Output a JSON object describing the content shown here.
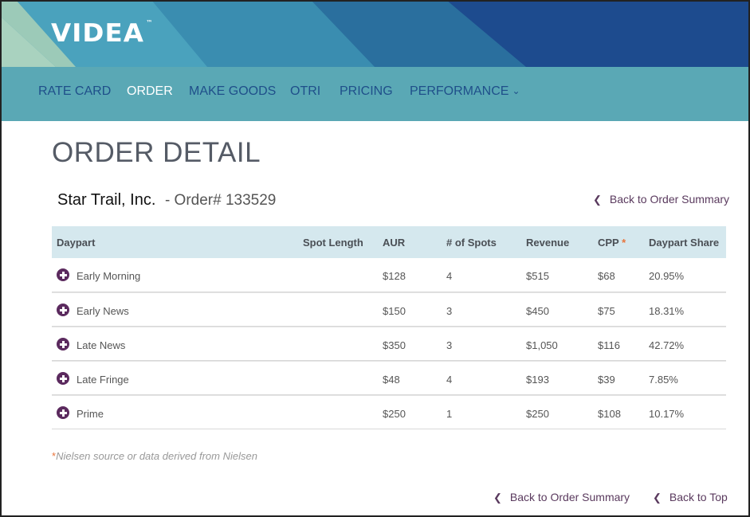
{
  "brand": {
    "logo_text": "VIDEA",
    "trademark": "™"
  },
  "nav": {
    "items": [
      {
        "label": "RATE CARD"
      },
      {
        "label": "ORDER"
      },
      {
        "label": "MAKE GOODS"
      },
      {
        "label": "OTRI"
      },
      {
        "label": "PRICING"
      },
      {
        "label": "PERFORMANCE"
      }
    ],
    "active": "ORDER"
  },
  "page": {
    "title": "ORDER DETAIL",
    "client_name": "Star Trail, Inc.",
    "order_number": "- Order# 133529",
    "back_to_summary": "Back to Order Summary",
    "back_to_top": "Back to Top"
  },
  "table": {
    "headers": [
      "Daypart",
      "Spot Length",
      "AUR",
      "# of Spots",
      "Revenue",
      "CPP",
      "Daypart Share"
    ],
    "cpp_marker": "*",
    "rows": [
      {
        "daypart": "Early Morning",
        "spot_length": "",
        "aur": "$128",
        "spots": "4",
        "revenue": "$515",
        "cpp": "$68",
        "share": "20.95%"
      },
      {
        "daypart": "Early News",
        "spot_length": "",
        "aur": "$150",
        "spots": "3",
        "revenue": "$450",
        "cpp": "$75",
        "share": "18.31%"
      },
      {
        "daypart": "Late News",
        "spot_length": "",
        "aur": "$350",
        "spots": "3",
        "revenue": "$1,050",
        "cpp": "$116",
        "share": "42.72%"
      },
      {
        "daypart": "Late Fringe",
        "spot_length": "",
        "aur": "$48",
        "spots": "4",
        "revenue": "$193",
        "cpp": "$39",
        "share": "7.85%"
      },
      {
        "daypart": "Prime",
        "spot_length": "",
        "aur": "$250",
        "spots": "1",
        "revenue": "$250",
        "cpp": "$108",
        "share": "10.17%"
      }
    ]
  },
  "footnote": {
    "marker": "*",
    "text": "Nielsen source or data derived from Nielsen"
  },
  "colors": {
    "nav_bg": "#5aa8b5",
    "nav_text": "#1f4f8a",
    "accent_purple": "#5b2a5e",
    "header_row_bg": "#d5e8ee",
    "asterisk": "#e8743b"
  },
  "icons": {
    "expand": "plus-circle-icon",
    "back": "chevron-left-icon",
    "dropdown": "chevron-down-icon"
  }
}
